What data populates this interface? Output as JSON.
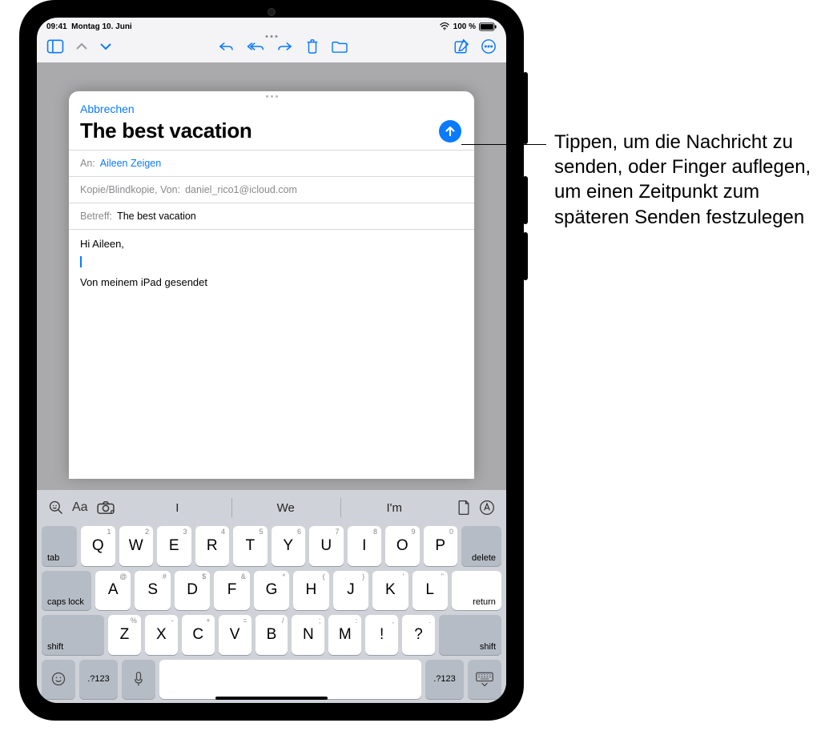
{
  "status": {
    "time": "09:41",
    "date": "Montag 10. Juni",
    "battery": "100 %"
  },
  "compose": {
    "cancel": "Abbrechen",
    "title": "The best vacation",
    "to_label": "An:",
    "to_value": "Aileen Zeigen",
    "cc_label": "Kopie/Blindkopie, Von:",
    "cc_value": "daniel_rico1@icloud.com",
    "subject_label": "Betreff:",
    "subject_value": "The best vacation",
    "body_greeting": "Hi Aileen,",
    "signature": "Von meinem iPad gesendet"
  },
  "suggestions": {
    "aa": "Aa",
    "s1": "I",
    "s2": "We",
    "s3": "I'm"
  },
  "keys": {
    "row1": [
      {
        "main": "Q",
        "hint": "1"
      },
      {
        "main": "W",
        "hint": "2"
      },
      {
        "main": "E",
        "hint": "3"
      },
      {
        "main": "R",
        "hint": "4"
      },
      {
        "main": "T",
        "hint": "5"
      },
      {
        "main": "Y",
        "hint": "6"
      },
      {
        "main": "U",
        "hint": "7"
      },
      {
        "main": "I",
        "hint": "8"
      },
      {
        "main": "O",
        "hint": "9"
      },
      {
        "main": "P",
        "hint": "0"
      }
    ],
    "row2": [
      {
        "main": "A",
        "hint": "@"
      },
      {
        "main": "S",
        "hint": "#"
      },
      {
        "main": "D",
        "hint": "$"
      },
      {
        "main": "F",
        "hint": "&"
      },
      {
        "main": "G",
        "hint": "*"
      },
      {
        "main": "H",
        "hint": "("
      },
      {
        "main": "J",
        "hint": ")"
      },
      {
        "main": "K",
        "hint": "'"
      },
      {
        "main": "L",
        "hint": "\""
      }
    ],
    "row3": [
      {
        "main": "Z",
        "hint": "%"
      },
      {
        "main": "X",
        "hint": "-"
      },
      {
        "main": "C",
        "hint": "+"
      },
      {
        "main": "V",
        "hint": "="
      },
      {
        "main": "B",
        "hint": "/"
      },
      {
        "main": "N",
        "hint": ";"
      },
      {
        "main": "M",
        "hint": ":"
      },
      {
        "main": "!",
        "hint": ","
      },
      {
        "main": "?",
        "hint": "."
      }
    ],
    "tab": "tab",
    "delete": "delete",
    "caps": "caps lock",
    "return": "return",
    "shift": "shift",
    "sym": ".?123"
  },
  "callout": {
    "text": "Tippen, um die Nachricht zu senden, oder Finger auflegen, um einen Zeitpunkt zum späteren Senden festzulegen"
  }
}
